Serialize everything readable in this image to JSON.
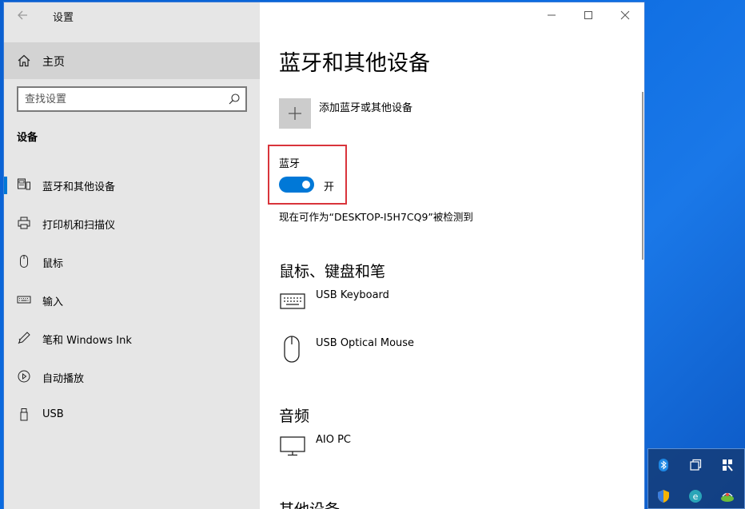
{
  "window": {
    "app_title": "设置"
  },
  "sidebar": {
    "home_label": "主页",
    "search_placeholder": "查找设置",
    "section_label": "设备",
    "items": [
      {
        "label": "蓝牙和其他设备",
        "icon": "bluetooth-devices-icon",
        "selected": true
      },
      {
        "label": "打印机和扫描仪",
        "icon": "printer-icon"
      },
      {
        "label": "鼠标",
        "icon": "mouse-icon"
      },
      {
        "label": "输入",
        "icon": "keyboard-icon"
      },
      {
        "label": "笔和 Windows Ink",
        "icon": "pen-icon"
      },
      {
        "label": "自动播放",
        "icon": "autoplay-icon"
      },
      {
        "label": "USB",
        "icon": "usb-icon"
      }
    ]
  },
  "main": {
    "page_title": "蓝牙和其他设备",
    "add_device_label": "添加蓝牙或其他设备",
    "bluetooth": {
      "label": "蓝牙",
      "state": "开",
      "on": true
    },
    "discoverable_text": "现在可作为“DESKTOP-I5H7CQ9”被检测到",
    "sections": [
      {
        "heading": "鼠标、键盘和笔",
        "devices": [
          {
            "name": "USB Keyboard",
            "icon": "keyboard-icon"
          },
          {
            "name": "USB Optical Mouse",
            "icon": "mouse-icon"
          }
        ]
      },
      {
        "heading": "音频",
        "devices": [
          {
            "name": "AIO PC",
            "icon": "monitor-icon"
          }
        ]
      },
      {
        "heading": "其他设备",
        "devices": []
      }
    ]
  },
  "tray": {
    "icons": [
      "bluetooth-icon",
      "window-switch-icon",
      "pin-icon",
      "shield-icon",
      "app-e-icon",
      "network-icon"
    ]
  },
  "colors": {
    "accent": "#0078d7",
    "highlight_box": "#d9343b",
    "sidebar_bg": "#e6e6e6",
    "desktop": "#0b6be0"
  }
}
